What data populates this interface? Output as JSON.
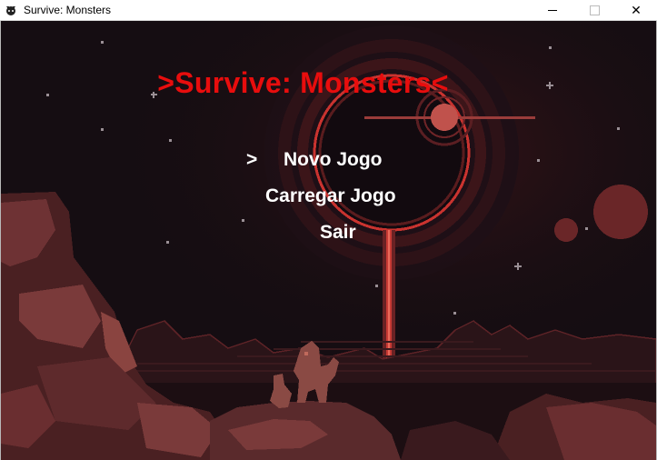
{
  "window": {
    "title": "Survive: Monsters",
    "icon": "monster-app-icon",
    "controls": [
      "minimize",
      "maximize",
      "close"
    ]
  },
  "game": {
    "title": ">Survive: Monsters<",
    "menu_cursor": ">",
    "menu": [
      {
        "label": "Novo Jogo",
        "selected": true
      },
      {
        "label": "Carregar Jogo",
        "selected": false
      },
      {
        "label": "Sair",
        "selected": false
      }
    ]
  },
  "colors": {
    "title": "#e80d0d",
    "menu_text": "#ffffff",
    "sky": "#150d12",
    "planet_ring": "#c9332f",
    "rock_dark": "#3b1a1c",
    "rock_light": "#7a3a3a"
  }
}
